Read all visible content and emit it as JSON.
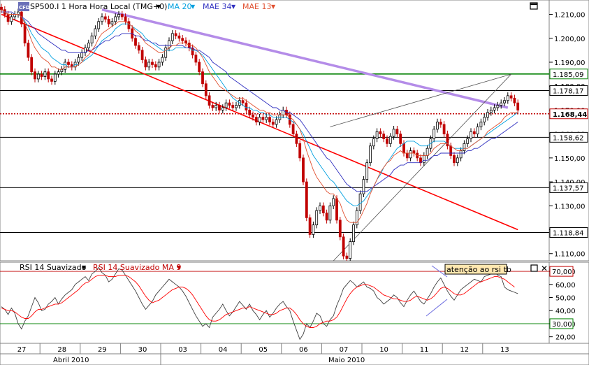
{
  "header": {
    "logo": "CFD",
    "symbol": "SP500.I 1 Hora Hora Local (TMG+0)",
    "ma20": "MA 20",
    "mae34": "MAE 34",
    "mae13": "MAE 13"
  },
  "rsi_header": {
    "rsi": "RSI 14 Suavizado",
    "rsi_ma": "RSI 14 Suavizado MA 9",
    "note": "atenção ao rsi tb"
  },
  "colors": {
    "ma20": "#00a0e0",
    "mae34": "#3030c0",
    "mae13": "#e05030",
    "candle_up": "#000000",
    "candle_down": "#c00000",
    "trend_red": "#ff0000",
    "trend_purple": "#b48ce8",
    "level_green": "#008000",
    "rsi_line": "#404040",
    "rsi_ma_line": "#ff0000"
  },
  "chart_data": [
    {
      "type": "candlestick",
      "title": "SP500.I 1 Hora Hora Local (TMG+0)",
      "ylim": [
        1107,
        1216
      ],
      "yticks": [
        1210,
        1200,
        1190,
        1180,
        1170,
        1160,
        1150,
        1140,
        1130,
        1120,
        1110
      ],
      "ytick_labels": [
        "1.210,00",
        "1.200,00",
        "1.190,00",
        "1.180,00",
        "1.170,00",
        "1.160,00",
        "1.150,00",
        "1.140,00",
        "1.130,00",
        "1.120,00",
        "1.110,00"
      ],
      "x_days": [
        "27",
        "28",
        "29",
        "30",
        "03",
        "04",
        "05",
        "06",
        "07",
        "10",
        "11",
        "12",
        "13"
      ],
      "x_months": [
        "Abril 2010",
        "Maio 2010"
      ],
      "levels": [
        {
          "value": 1185.09,
          "label": "1.185,09",
          "style": "green"
        },
        {
          "value": 1178.17,
          "label": "1.178,17",
          "style": "black"
        },
        {
          "value": 1168.44,
          "label": "1.168,44",
          "style": "red-dotted"
        },
        {
          "value": 1158.62,
          "label": "1.158,62",
          "style": "black"
        },
        {
          "value": 1137.57,
          "label": "1.137,57",
          "style": "black"
        },
        {
          "value": 1118.84,
          "label": "1.118,84",
          "style": "black"
        }
      ],
      "close": [
        1212,
        1210,
        1207,
        1209,
        1210,
        1211,
        1206,
        1198,
        1192,
        1186,
        1183,
        1185,
        1184,
        1186,
        1183,
        1182,
        1185,
        1186,
        1187,
        1190,
        1189,
        1188,
        1190,
        1192,
        1194,
        1196,
        1198,
        1201,
        1204,
        1207,
        1209,
        1208,
        1206,
        1207,
        1209,
        1210,
        1209,
        1207,
        1204,
        1200,
        1197,
        1195,
        1191,
        1188,
        1190,
        1189,
        1188,
        1190,
        1192,
        1196,
        1199,
        1202,
        1201,
        1200,
        1199,
        1198,
        1196,
        1193,
        1190,
        1186,
        1181,
        1176,
        1172,
        1171,
        1172,
        1170,
        1171,
        1173,
        1172,
        1171,
        1172,
        1174,
        1173,
        1170,
        1168,
        1167,
        1165,
        1167,
        1166,
        1167,
        1165,
        1164,
        1166,
        1168,
        1170,
        1168,
        1164,
        1160,
        1156,
        1150,
        1140,
        1125,
        1118,
        1122,
        1128,
        1130,
        1127,
        1124,
        1130,
        1133,
        1124,
        1117,
        1109,
        1108,
        1115,
        1122,
        1128,
        1135,
        1141,
        1148,
        1155,
        1158,
        1161,
        1160,
        1158,
        1156,
        1159,
        1162,
        1160,
        1156,
        1152,
        1150,
        1153,
        1152,
        1150,
        1148,
        1151,
        1154,
        1158,
        1162,
        1165,
        1164,
        1160,
        1155,
        1151,
        1148,
        1150,
        1153,
        1156,
        1158,
        1161,
        1160,
        1163,
        1165,
        1167,
        1169,
        1170,
        1171,
        1172,
        1173,
        1174,
        1176,
        1175,
        1173,
        1170
      ],
      "series": [
        {
          "name": "MA 20",
          "values": [
            1212,
            1211,
            1210,
            1210,
            1210,
            1210,
            1209,
            1207,
            1205,
            1202,
            1200,
            1198,
            1196,
            1195,
            1194,
            1192,
            1191,
            1190,
            1189,
            1189,
            1188,
            1188,
            1189,
            1189,
            1190,
            1191,
            1192,
            1193,
            1195,
            1197,
            1199,
            1200,
            1201,
            1202,
            1204,
            1205,
            1206,
            1206,
            1206,
            1205,
            1204,
            1203,
            1202,
            1200,
            1199,
            1198,
            1197,
            1196,
            1195,
            1195,
            1195,
            1195,
            1196,
            1196,
            1196,
            1196,
            1196,
            1195,
            1195,
            1194,
            1193,
            1191,
            1189,
            1187,
            1185,
            1183,
            1181,
            1179,
            1177,
            1175,
            1174,
            1173,
            1172,
            1171,
            1171,
            1170,
            1170,
            1169,
            1169,
            1168,
            1168,
            1167,
            1167,
            1167,
            1167,
            1167,
            1166,
            1165,
            1164,
            1162,
            1160,
            1157,
            1154,
            1151,
            1149,
            1147,
            1145,
            1143,
            1141,
            1140,
            1138,
            1136,
            1134,
            1132,
            1131,
            1130,
            1130,
            1131,
            1132,
            1134,
            1136,
            1138,
            1141,
            1143,
            1146,
            1148,
            1150,
            1152,
            1154,
            1155,
            1156,
            1157,
            1157,
            1157,
            1156,
            1155,
            1155,
            1155,
            1156,
            1157,
            1157,
            1157,
            1157,
            1156,
            1155,
            1154,
            1154,
            1154,
            1154,
            1154,
            1155,
            1156,
            1157,
            1158,
            1159,
            1160,
            1161,
            1162,
            1163,
            1164,
            1165,
            1166,
            1167,
            1168,
            1169
          ]
        },
        {
          "name": "MAE 34",
          "values": [
            1211,
            1211,
            1211,
            1211,
            1210,
            1210,
            1209,
            1208,
            1207,
            1205,
            1204,
            1202,
            1201,
            1200,
            1199,
            1198,
            1197,
            1196,
            1195,
            1195,
            1194,
            1194,
            1194,
            1194,
            1194,
            1194,
            1195,
            1195,
            1196,
            1197,
            1198,
            1199,
            1199,
            1200,
            1201,
            1201,
            1202,
            1202,
            1202,
            1202,
            1201,
            1201,
            1200,
            1199,
            1199,
            1198,
            1198,
            1197,
            1197,
            1197,
            1197,
            1197,
            1197,
            1197,
            1197,
            1196,
            1196,
            1196,
            1195,
            1195,
            1194,
            1193,
            1192,
            1190,
            1189,
            1188,
            1187,
            1186,
            1184,
            1183,
            1182,
            1181,
            1180,
            1179,
            1178,
            1177,
            1176,
            1175,
            1174,
            1173,
            1172,
            1171,
            1171,
            1170,
            1170,
            1169,
            1169,
            1168,
            1167,
            1166,
            1164,
            1162,
            1160,
            1158,
            1156,
            1154,
            1152,
            1150,
            1149,
            1147,
            1145,
            1143,
            1141,
            1139,
            1138,
            1137,
            1136,
            1136,
            1136,
            1136,
            1137,
            1138,
            1139,
            1140,
            1141,
            1142,
            1143,
            1145,
            1146,
            1147,
            1147,
            1148,
            1148,
            1148,
            1148,
            1148,
            1149,
            1149,
            1150,
            1151,
            1151,
            1152,
            1152,
            1152,
            1152,
            1152,
            1152,
            1152,
            1152,
            1153,
            1153,
            1154,
            1154,
            1155,
            1156,
            1157,
            1158,
            1158,
            1159,
            1160,
            1161,
            1162,
            1163,
            1164,
            1165
          ]
        },
        {
          "name": "MAE 13",
          "values": [
            1212,
            1211,
            1210,
            1210,
            1210,
            1210,
            1209,
            1206,
            1203,
            1199,
            1196,
            1194,
            1192,
            1191,
            1190,
            1188,
            1188,
            1187,
            1187,
            1188,
            1188,
            1188,
            1188,
            1189,
            1190,
            1192,
            1193,
            1195,
            1197,
            1200,
            1202,
            1203,
            1204,
            1205,
            1206,
            1207,
            1207,
            1207,
            1206,
            1205,
            1203,
            1202,
            1200,
            1198,
            1197,
            1196,
            1195,
            1194,
            1194,
            1195,
            1196,
            1197,
            1197,
            1198,
            1198,
            1198,
            1197,
            1197,
            1196,
            1194,
            1192,
            1189,
            1186,
            1184,
            1182,
            1180,
            1179,
            1178,
            1177,
            1176,
            1175,
            1175,
            1175,
            1174,
            1173,
            1172,
            1171,
            1170,
            1170,
            1169,
            1169,
            1168,
            1168,
            1168,
            1168,
            1168,
            1167,
            1166,
            1164,
            1162,
            1158,
            1153,
            1149,
            1145,
            1142,
            1140,
            1138,
            1136,
            1135,
            1135,
            1133,
            1131,
            1127,
            1124,
            1123,
            1123,
            1123,
            1125,
            1128,
            1131,
            1135,
            1138,
            1141,
            1144,
            1146,
            1148,
            1149,
            1151,
            1152,
            1153,
            1152,
            1152,
            1152,
            1152,
            1151,
            1151,
            1151,
            1151,
            1152,
            1154,
            1155,
            1156,
            1156,
            1156,
            1155,
            1154,
            1153,
            1153,
            1154,
            1154,
            1155,
            1156,
            1157,
            1158,
            1159,
            1161,
            1162,
            1163,
            1164,
            1165,
            1167,
            1168,
            1169,
            1169,
            1169
          ]
        }
      ],
      "trendlines": [
        {
          "name": "red-downtrend",
          "from": [
            0,
            1210
          ],
          "to": [
            154,
            1120
          ]
        },
        {
          "name": "purple-downtrend",
          "from": [
            30,
            1212
          ],
          "to": [
            151,
            1171
          ]
        },
        {
          "name": "channel-upper",
          "from": [
            98,
            1163
          ],
          "to": [
            152,
            1185
          ]
        },
        {
          "name": "channel-lower",
          "from": [
            99,
            1107
          ],
          "to": [
            152,
            1185
          ]
        }
      ]
    },
    {
      "type": "line",
      "title": "RSI 14 Suavizado",
      "ylim": [
        15,
        77
      ],
      "yticks": [
        70,
        60,
        50,
        40,
        30,
        20
      ],
      "ytick_labels": [
        "70,00",
        "60,00",
        "50,00",
        "40,00",
        "30,00",
        "20,00"
      ],
      "levels": [
        {
          "value": 70,
          "style": "red"
        },
        {
          "value": 30,
          "style": "green"
        }
      ],
      "series": [
        {
          "name": "RSI 14 Suavizado",
          "values": [
            43,
            41,
            37,
            42,
            38,
            30,
            26,
            32,
            36,
            43,
            50,
            46,
            40,
            41,
            45,
            47,
            50,
            45,
            49,
            52,
            54,
            56,
            60,
            62,
            64,
            66,
            63,
            68,
            70,
            73,
            69,
            67,
            62,
            64,
            68,
            72,
            71,
            67,
            63,
            59,
            55,
            50,
            45,
            41,
            44,
            47,
            52,
            55,
            58,
            61,
            64,
            62,
            60,
            58,
            55,
            51,
            46,
            41,
            36,
            32,
            28,
            30,
            27,
            35,
            38,
            41,
            45,
            40,
            36,
            39,
            43,
            47,
            44,
            41,
            45,
            40,
            37,
            33,
            37,
            40,
            35,
            38,
            42,
            45,
            47,
            43,
            40,
            32,
            25,
            18,
            22,
            30,
            27,
            32,
            38,
            36,
            30,
            28,
            33,
            36,
            44,
            50,
            57,
            60,
            63,
            61,
            58,
            60,
            62,
            58,
            57,
            55,
            50,
            48,
            45,
            47,
            49,
            52,
            50,
            46,
            43,
            48,
            52,
            55,
            51,
            47,
            45,
            49,
            53,
            58,
            62,
            65,
            60,
            55,
            51,
            48,
            52,
            56,
            58,
            60,
            62,
            64,
            63,
            62,
            66,
            67,
            68,
            70,
            67,
            66,
            58,
            56,
            55,
            54,
            53
          ]
        },
        {
          "name": "RSI 14 Suavizado MA 9",
          "values": [
            42,
            41,
            40,
            40,
            39,
            37,
            35,
            34,
            34,
            36,
            39,
            41,
            41,
            42,
            43,
            44,
            45,
            45,
            46,
            48,
            50,
            52,
            54,
            56,
            59,
            61,
            62,
            64,
            66,
            67,
            67,
            67,
            66,
            66,
            66,
            67,
            67,
            67,
            66,
            64,
            62,
            59,
            55,
            51,
            48,
            46,
            47,
            48,
            50,
            52,
            54,
            56,
            57,
            58,
            58,
            57,
            55,
            52,
            48,
            44,
            40,
            36,
            33,
            32,
            32,
            33,
            35,
            37,
            38,
            39,
            40,
            41,
            42,
            42,
            43,
            42,
            41,
            40,
            39,
            38,
            37,
            37,
            38,
            40,
            41,
            42,
            42,
            40,
            37,
            33,
            30,
            28,
            27,
            27,
            28,
            30,
            31,
            32,
            32,
            33,
            35,
            39,
            44,
            49,
            53,
            56,
            58,
            59,
            60,
            60,
            59,
            58,
            56,
            54,
            52,
            51,
            50,
            49,
            49,
            48,
            47,
            47,
            48,
            50,
            51,
            50,
            49,
            48,
            49,
            51,
            54,
            57,
            58,
            57,
            55,
            53,
            52,
            52,
            53,
            55,
            57,
            59,
            61,
            62,
            63,
            64,
            65,
            66,
            66,
            65,
            64,
            62,
            60,
            58
          ]
        }
      ]
    }
  ]
}
